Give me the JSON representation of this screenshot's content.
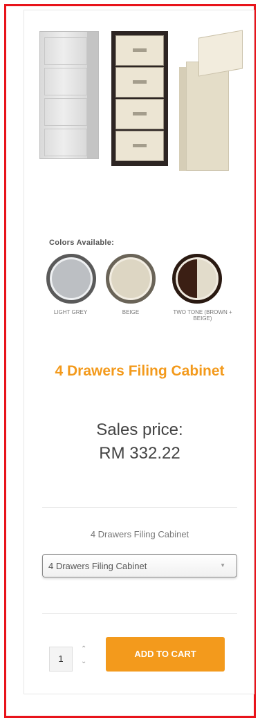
{
  "product": {
    "image": {
      "colors_title": "Colors Available:",
      "swatches": [
        {
          "label": "LIGHT GREY",
          "color": "#bcbfc3"
        },
        {
          "label": "BEIGE",
          "color": "#ddd6c3"
        },
        {
          "label": "TWO TONE (BROWN + BEIGE)",
          "color": "#3b1f14"
        }
      ]
    },
    "name": "4 Drawers Filing Cabinet",
    "price_label": "Sales price:",
    "price_value": "RM 332.22",
    "variant_label": "4 Drawers Filing Cabinet",
    "variant_select": {
      "selected": "4 Drawers Filing Cabinet"
    },
    "quantity": "1",
    "add_to_cart_label": "ADD TO CART"
  },
  "colors": {
    "accent": "#f39a1c",
    "frame": "#e8141b"
  }
}
